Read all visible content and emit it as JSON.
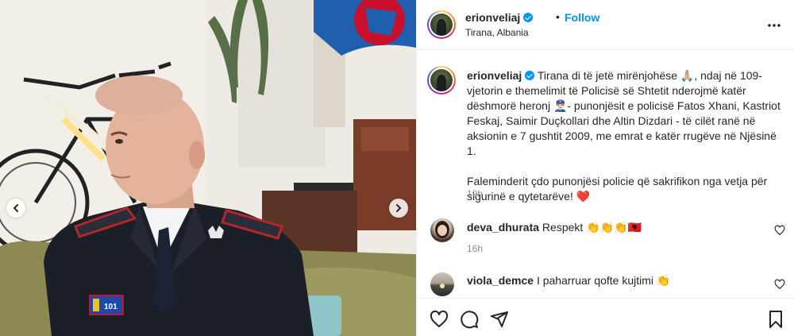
{
  "post": {
    "username": "erionveliaj",
    "dot": "•",
    "follow_label": "Follow",
    "location": "Tirana, Albania"
  },
  "caption": {
    "username": "erionveliaj",
    "paragraph1": " Tirana di të jetë mirënjohëse 🙏🏼, ndaj në 109-vjetorin e themelimit të Policisë së Shtetit nderojmë katër dëshmorë heronj 👮🏻‍♂️- punonjësit e policisë Fatos Xhani, Kastriot Feskaj, Saimir Duçkollari dhe Altin Dizdari - të cilët ranë në aksionin e 7 gushtit 2009, me emrat e katër rrugëve në Njësinë 1.",
    "paragraph2": "Faleminderit çdo punonjësi policie që sakrifikon nga vetja për sigurinë e qytetarëve! ❤️",
    "time": "19h"
  },
  "comments": [
    {
      "username": "deva_dhurata",
      "text": " Respekt 👏👏👏🇦🇱",
      "time": "16h"
    },
    {
      "username": "viola_demce",
      "text": " I paharruar qofte kujtimi 👏",
      "time": ""
    }
  ],
  "media": {
    "badge_number": "101"
  },
  "icons": {
    "more": "more-horizontal-icon",
    "verified": "verified-badge-icon",
    "like": "heart-icon",
    "comment": "comment-icon",
    "share": "share-icon",
    "save": "bookmark-icon",
    "prev": "chevron-left-icon",
    "next": "chevron-right-icon"
  },
  "colors": {
    "accent": "#0095f6",
    "text": "#262626",
    "muted": "#8e8e8e",
    "divider": "#efefef"
  }
}
